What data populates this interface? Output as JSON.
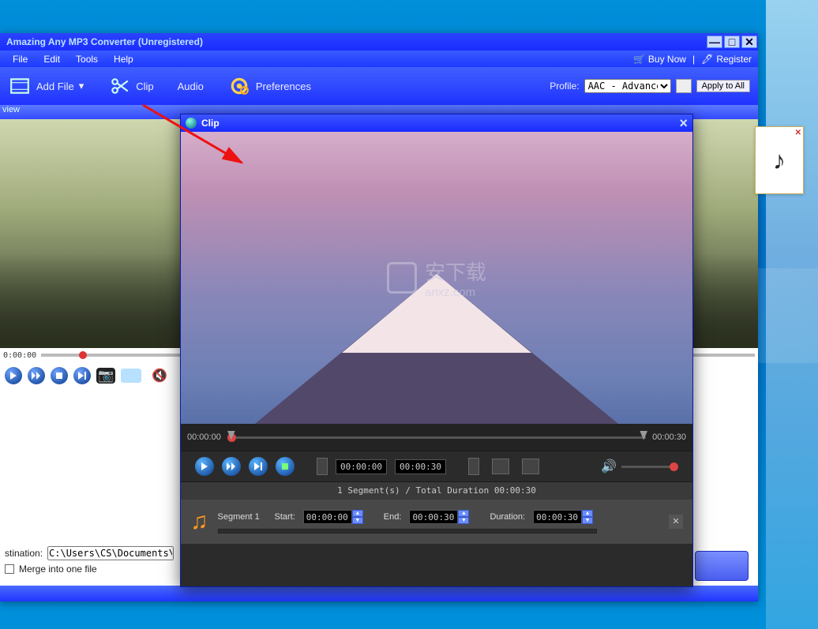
{
  "app": {
    "title": "Amazing Any MP3 Converter (Unregistered)",
    "menus": {
      "file": "File",
      "edit": "Edit",
      "tools": "Tools",
      "help": "Help"
    },
    "headerlinks": {
      "buy": "Buy Now",
      "register": "Register"
    },
    "toolbar": {
      "addfile": "Add File",
      "clip": "Clip",
      "audio": "Audio",
      "prefs": "Preferences",
      "profile_label": "Profile:",
      "profile_value": "AAC - Advanced",
      "apply": "Apply to All"
    },
    "preview_label": "view",
    "mainseek": {
      "start": "0:00:00"
    },
    "bottom": {
      "dest_label": "stination:",
      "dest_path": "C:\\Users\\CS\\Documents\\Amazi",
      "merge_label": "Merge into one file"
    }
  },
  "clip": {
    "title": "Clip",
    "seek": {
      "start": "00:00:00",
      "end": "00:00:30"
    },
    "ctrl": {
      "in": "00:00:00",
      "out": "00:00:30"
    },
    "seginfo": "1 Segment(s) / Total Duration 00:00:30",
    "segment": {
      "name": "Segment 1",
      "start_label": "Start:",
      "start": "00:00:00",
      "end_label": "End:",
      "end": "00:00:30",
      "dur_label": "Duration:",
      "dur": "00:00:30"
    },
    "watermark": {
      "text1": "安下载",
      "text2": "anxz.com"
    }
  }
}
